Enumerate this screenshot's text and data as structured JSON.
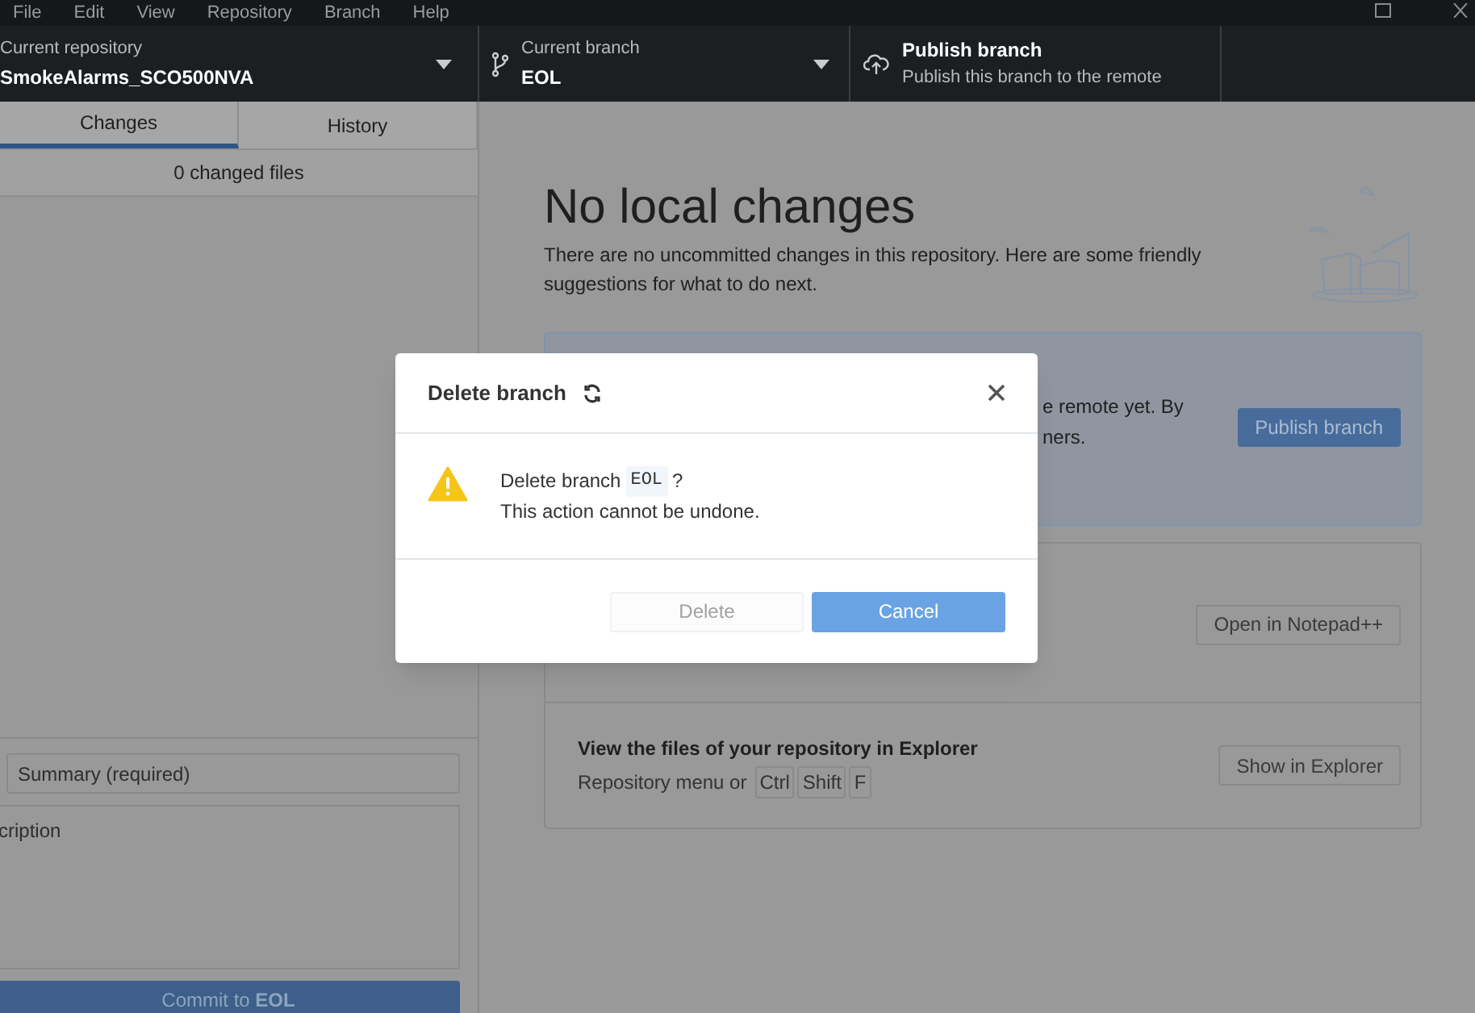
{
  "menu": [
    "File",
    "Edit",
    "View",
    "Repository",
    "Branch",
    "Help"
  ],
  "toolbar": {
    "repository": {
      "label": "Current repository",
      "value": "SmokeAlarms_SCO500NVA"
    },
    "branch": {
      "label": "Current branch",
      "value": "EOL"
    },
    "publish": {
      "title": "Publish branch",
      "description": "Publish this branch to the remote"
    }
  },
  "sidebar": {
    "tabs": [
      {
        "label": "Changes",
        "selected": true
      },
      {
        "label": "History",
        "selected": false
      }
    ],
    "changed_files": "0 changed files",
    "summary": {
      "placeholder": "Summary (required)"
    },
    "description": {
      "placeholder": "cription"
    },
    "commit_button": "Commit to **EOL**"
  },
  "main": {
    "heading": "No local changes",
    "intro": "There are no uncommitted changes in this repository. Here are some friendly suggestions for what to do next.",
    "publish_card": {
      "lines": [
        "e remote yet. By",
        "ners."
      ],
      "button": "Publish branch"
    },
    "editor_card": {
      "button": "Open in Notepad++"
    },
    "explorer_card": {
      "title": "View the files of your repository in Explorer",
      "hint": "Repository menu or",
      "keys": [
        "Ctrl",
        "Shift",
        "F"
      ],
      "button": "Show in Explorer"
    }
  },
  "dialog": {
    "title": "Delete branch",
    "message": "Delete branch",
    "branch": "EOL",
    "question_mark": "?",
    "note": "This action cannot be undone.",
    "buttons": [
      {
        "label": "Delete",
        "kind": "secondary",
        "disabled": true
      },
      {
        "label": "Cancel",
        "kind": "primary",
        "disabled": false
      }
    ]
  }
}
